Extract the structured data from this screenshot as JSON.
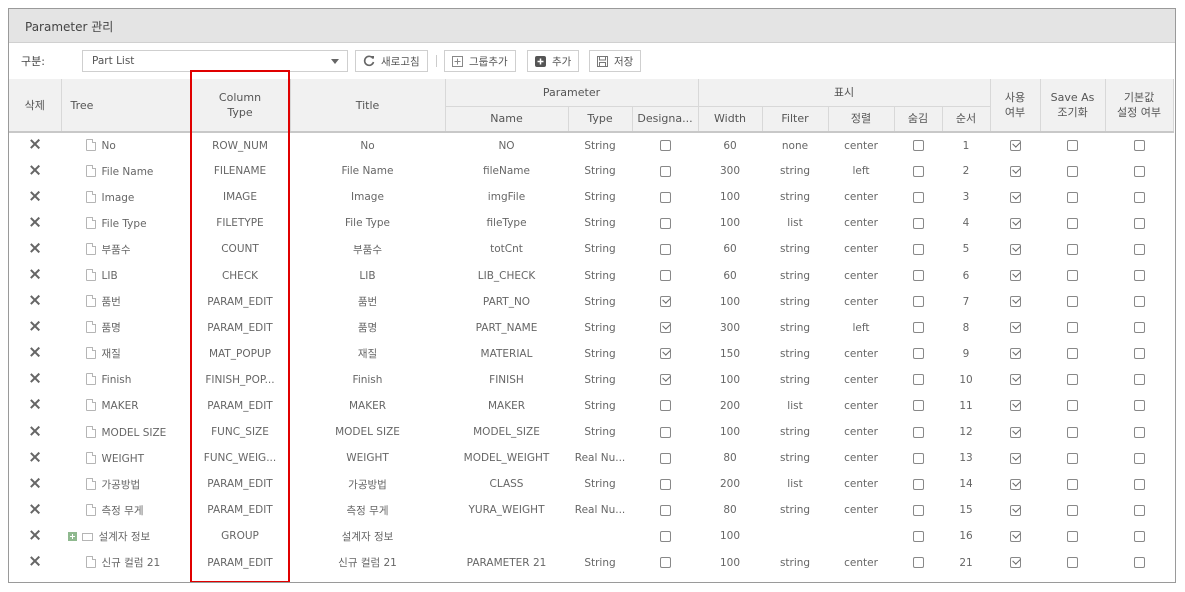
{
  "window": {
    "title": "Parameter 관리"
  },
  "toolbar": {
    "category_label": "구분:",
    "category_value": "Part List",
    "refresh_label": "새로고침",
    "add_group_label": "그룹추가",
    "add_label": "추가",
    "save_label": "저장"
  },
  "headers": {
    "delete": "삭제",
    "tree": "Tree",
    "column_type_1": "Column",
    "column_type_2": "Type",
    "title": "Title",
    "parameter": "Parameter",
    "param_name": "Name",
    "param_type": "Type",
    "param_designated": "Designa...",
    "display": "표시",
    "width": "Width",
    "filter": "Filter",
    "align": "정렬",
    "hide": "숨김",
    "order": "순서",
    "use_1": "사용",
    "use_2": "여부",
    "saveas_1": "Save As",
    "saveas_2": "조기화",
    "default_1": "기본값",
    "default_2": "설정 여부"
  },
  "rows": [
    {
      "tree": "No",
      "coltype": "ROW_NUM",
      "title": "No",
      "pname": "NO",
      "ptype": "String",
      "designated": false,
      "width": "60",
      "filter": "none",
      "align": "center",
      "hidden": false,
      "order": "1",
      "use": true,
      "saveas": false,
      "default": false
    },
    {
      "tree": "File Name",
      "coltype": "FILENAME",
      "title": "File Name",
      "pname": "fileName",
      "ptype": "String",
      "designated": false,
      "width": "300",
      "filter": "string",
      "align": "left",
      "hidden": false,
      "order": "2",
      "use": true,
      "saveas": false,
      "default": false
    },
    {
      "tree": "Image",
      "coltype": "IMAGE",
      "title": "Image",
      "pname": "imgFile",
      "ptype": "String",
      "designated": false,
      "width": "100",
      "filter": "string",
      "align": "center",
      "hidden": false,
      "order": "3",
      "use": true,
      "saveas": false,
      "default": false
    },
    {
      "tree": "File Type",
      "coltype": "FILETYPE",
      "title": "File Type",
      "pname": "fileType",
      "ptype": "String",
      "designated": false,
      "width": "100",
      "filter": "list",
      "align": "center",
      "hidden": false,
      "order": "4",
      "use": true,
      "saveas": false,
      "default": false
    },
    {
      "tree": "부품수",
      "coltype": "COUNT",
      "title": "부품수",
      "pname": "totCnt",
      "ptype": "String",
      "designated": false,
      "width": "60",
      "filter": "string",
      "align": "center",
      "hidden": false,
      "order": "5",
      "use": true,
      "saveas": false,
      "default": false
    },
    {
      "tree": "LIB",
      "coltype": "CHECK",
      "title": "LIB",
      "pname": "LIB_CHECK",
      "ptype": "String",
      "designated": false,
      "width": "60",
      "filter": "string",
      "align": "center",
      "hidden": false,
      "order": "6",
      "use": true,
      "saveas": false,
      "default": false
    },
    {
      "tree": "품번",
      "coltype": "PARAM_EDIT",
      "title": "품번",
      "pname": "PART_NO",
      "ptype": "String",
      "designated": true,
      "width": "100",
      "filter": "string",
      "align": "center",
      "hidden": false,
      "order": "7",
      "use": true,
      "saveas": false,
      "default": false
    },
    {
      "tree": "품명",
      "coltype": "PARAM_EDIT",
      "title": "품명",
      "pname": "PART_NAME",
      "ptype": "String",
      "designated": true,
      "width": "300",
      "filter": "string",
      "align": "left",
      "hidden": false,
      "order": "8",
      "use": true,
      "saveas": false,
      "default": false
    },
    {
      "tree": "재질",
      "coltype": "MAT_POPUP",
      "title": "재질",
      "pname": "MATERIAL",
      "ptype": "String",
      "designated": true,
      "width": "150",
      "filter": "string",
      "align": "center",
      "hidden": false,
      "order": "9",
      "use": true,
      "saveas": false,
      "default": false
    },
    {
      "tree": "Finish",
      "coltype": "FINISH_POP...",
      "title": "Finish",
      "pname": "FINISH",
      "ptype": "String",
      "designated": true,
      "width": "100",
      "filter": "string",
      "align": "center",
      "hidden": false,
      "order": "10",
      "use": true,
      "saveas": false,
      "default": false
    },
    {
      "tree": "MAKER",
      "coltype": "PARAM_EDIT",
      "title": "MAKER",
      "pname": "MAKER",
      "ptype": "String",
      "designated": false,
      "width": "200",
      "filter": "list",
      "align": "center",
      "hidden": false,
      "order": "11",
      "use": true,
      "saveas": false,
      "default": false
    },
    {
      "tree": "MODEL SIZE",
      "coltype": "FUNC_SIZE",
      "title": "MODEL SIZE",
      "pname": "MODEL_SIZE",
      "ptype": "String",
      "designated": false,
      "width": "100",
      "filter": "string",
      "align": "center",
      "hidden": false,
      "order": "12",
      "use": true,
      "saveas": false,
      "default": false
    },
    {
      "tree": "WEIGHT",
      "coltype": "FUNC_WEIG...",
      "title": "WEIGHT",
      "pname": "MODEL_WEIGHT",
      "ptype": "Real Nu...",
      "designated": false,
      "width": "80",
      "filter": "string",
      "align": "center",
      "hidden": false,
      "order": "13",
      "use": true,
      "saveas": false,
      "default": false
    },
    {
      "tree": "가공방법",
      "coltype": "PARAM_EDIT",
      "title": "가공방법",
      "pname": "CLASS",
      "ptype": "String",
      "designated": false,
      "width": "200",
      "filter": "list",
      "align": "center",
      "hidden": false,
      "order": "14",
      "use": true,
      "saveas": false,
      "default": false
    },
    {
      "tree": "측정 무게",
      "coltype": "PARAM_EDIT",
      "title": "측정 무게",
      "pname": "YURA_WEIGHT",
      "ptype": "Real Nu...",
      "designated": false,
      "width": "80",
      "filter": "string",
      "align": "center",
      "hidden": false,
      "order": "15",
      "use": true,
      "saveas": false,
      "default": false
    },
    {
      "tree": "설계자 정보",
      "group": true,
      "coltype": "GROUP",
      "title": "설계자 정보",
      "pname": "",
      "ptype": "",
      "designated": false,
      "width": "100",
      "filter": "",
      "align": "",
      "hidden": false,
      "order": "16",
      "use": true,
      "saveas": false,
      "default": false
    },
    {
      "tree": "신규 컬럼 21",
      "coltype": "PARAM_EDIT",
      "title": "신규 컬럼 21",
      "pname": "PARAMETER 21",
      "ptype": "String",
      "designated": false,
      "width": "100",
      "filter": "string",
      "align": "center",
      "hidden": false,
      "order": "21",
      "use": true,
      "saveas": false,
      "default": false
    }
  ],
  "colors": {
    "highlight_box": "#e00000",
    "header_bg": "#f1f1f1",
    "titlebar_bg": "#e4e4e4"
  }
}
